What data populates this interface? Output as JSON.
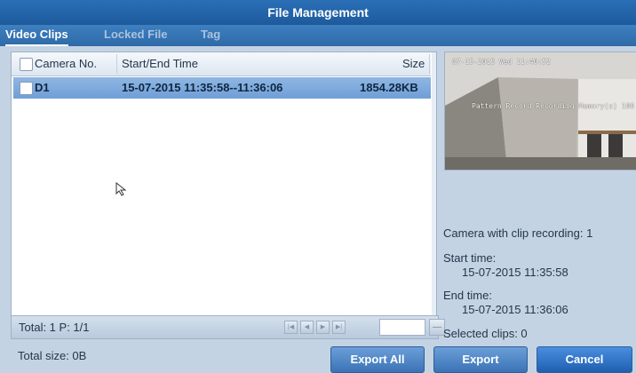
{
  "window": {
    "title": "File Management"
  },
  "tabs": [
    {
      "label": "Video Clips",
      "active": true
    },
    {
      "label": "Locked File",
      "active": false
    },
    {
      "label": "Tag",
      "active": false
    }
  ],
  "table": {
    "headers": {
      "camera": "Camera No.",
      "time": "Start/End Time",
      "size": "Size"
    },
    "rows": [
      {
        "camera": "D1",
        "time": "15-07-2015 11:35:58--11:36:06",
        "size": "1854.28KB",
        "selected": true
      }
    ]
  },
  "pagination": {
    "label": "Total: 1  P: 1/1",
    "page_value": "",
    "go_label": "—"
  },
  "footer": {
    "total_size": "Total size: 0B"
  },
  "preview": {
    "osd_date": "07-15-2015 Wed 11:40:52",
    "osd_banner": "Pattern Record Recording Memory(s) 100"
  },
  "info": {
    "camera_count": "Camera with clip recording: 1",
    "start_label": "Start time:",
    "start_value": "15-07-2015 11:35:58",
    "end_label": "End time:",
    "end_value": "15-07-2015 11:36:06",
    "selected": "Selected clips: 0"
  },
  "buttons": {
    "export_all": "Export All",
    "export": "Export",
    "cancel": "Cancel"
  },
  "colors": {
    "title_bar": "#1d5a9c",
    "selected_row": "#6f9fd6",
    "panel_bg": "#c4d3e3"
  },
  "icons": [
    "mouse-pointer-icon",
    "first-page-icon",
    "prev-page-icon",
    "next-page-icon",
    "last-page-icon",
    "go-icon"
  ]
}
